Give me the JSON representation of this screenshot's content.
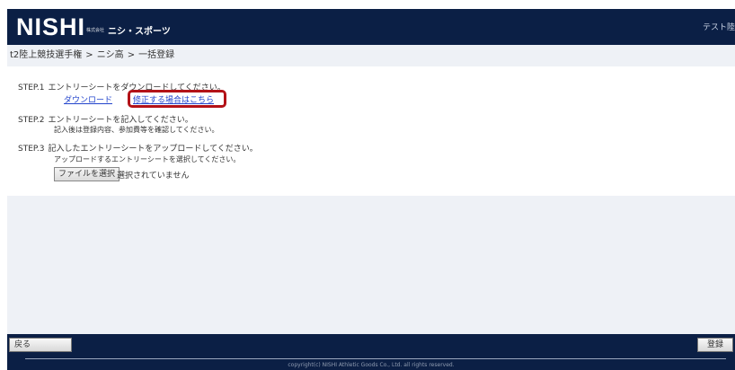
{
  "header": {
    "logo_text": "NISHI",
    "logo_corp": "株式会社",
    "logo_sub": "ニシ・スポーツ",
    "user_label": "テスト陸"
  },
  "breadcrumb": {
    "items": [
      "t2陸上競技選手権",
      "ニシ高",
      "一括登録"
    ],
    "separator": ">"
  },
  "steps": {
    "step1_label": "STEP.1",
    "step1_text": "エントリーシートをダウンロードしてください。",
    "download_link": "ダウンロード",
    "edit_link": "修正する場合はこちら",
    "step2_label": "STEP.2",
    "step2_text": "エントリーシートを記入してください。",
    "step2_note": "記入後は登録内容、参加費等を確認してください。",
    "step3_label": "STEP.3",
    "step3_text": "記入したエントリーシートをアップロードしてください。",
    "step3_note": "アップロードするエントリーシートを選択してください。",
    "file_button": "ファイルを選択",
    "file_status": "選択されていません"
  },
  "footer": {
    "back_button": "戻る",
    "register_button": "登録",
    "copyright": "copyright(c) NISHI Athletic Goods Co., Ltd. all rights reserved."
  },
  "colors": {
    "header_bg": "#0b1f45",
    "highlight": "#b31217",
    "link": "#2244cc"
  }
}
